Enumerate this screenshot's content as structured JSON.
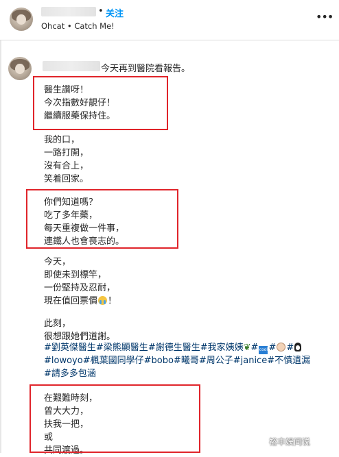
{
  "header": {
    "follow_label": "关注",
    "separator": "•",
    "subtitle": "Ohcat • Catch Me!",
    "more_label": "•••"
  },
  "post": {
    "first_line": "今天再到醫院看報告。",
    "paragraphs": [
      "醫生讚呀！\n今次指數好靚仔！\n繼續服藥保持住。",
      "我的口，\n一路打開，\n沒有合上，\n笑着回家。",
      "你們知道嗎？\n吃了多年藥，\n每天重複做一件事，\n連鐵人也會喪志的。",
      "今天，\n即使未到標竿，\n一份堅持及忍耐，\n現在值回票價",
      "此刻，\n很想跟她們道謝。",
      "在艱難時刻，\n曾大大力，\n扶我一把，\n或\n共同渡過。"
    ],
    "para4_end": "！",
    "hashtags": [
      "#劉英傑醫生",
      "#梁熊顯醫生",
      "#謝德生醫生",
      "#我家姨姨",
      "#",
      "#",
      "#",
      "#lowoyo",
      "#楓葉國同學仔",
      "#bobo",
      "#曦哥",
      "#周公子",
      "#janice",
      "#不慎遺漏",
      "#請多多包涵"
    ],
    "emoji_box_text": "cool"
  },
  "watermark": "裕丰娱间说"
}
